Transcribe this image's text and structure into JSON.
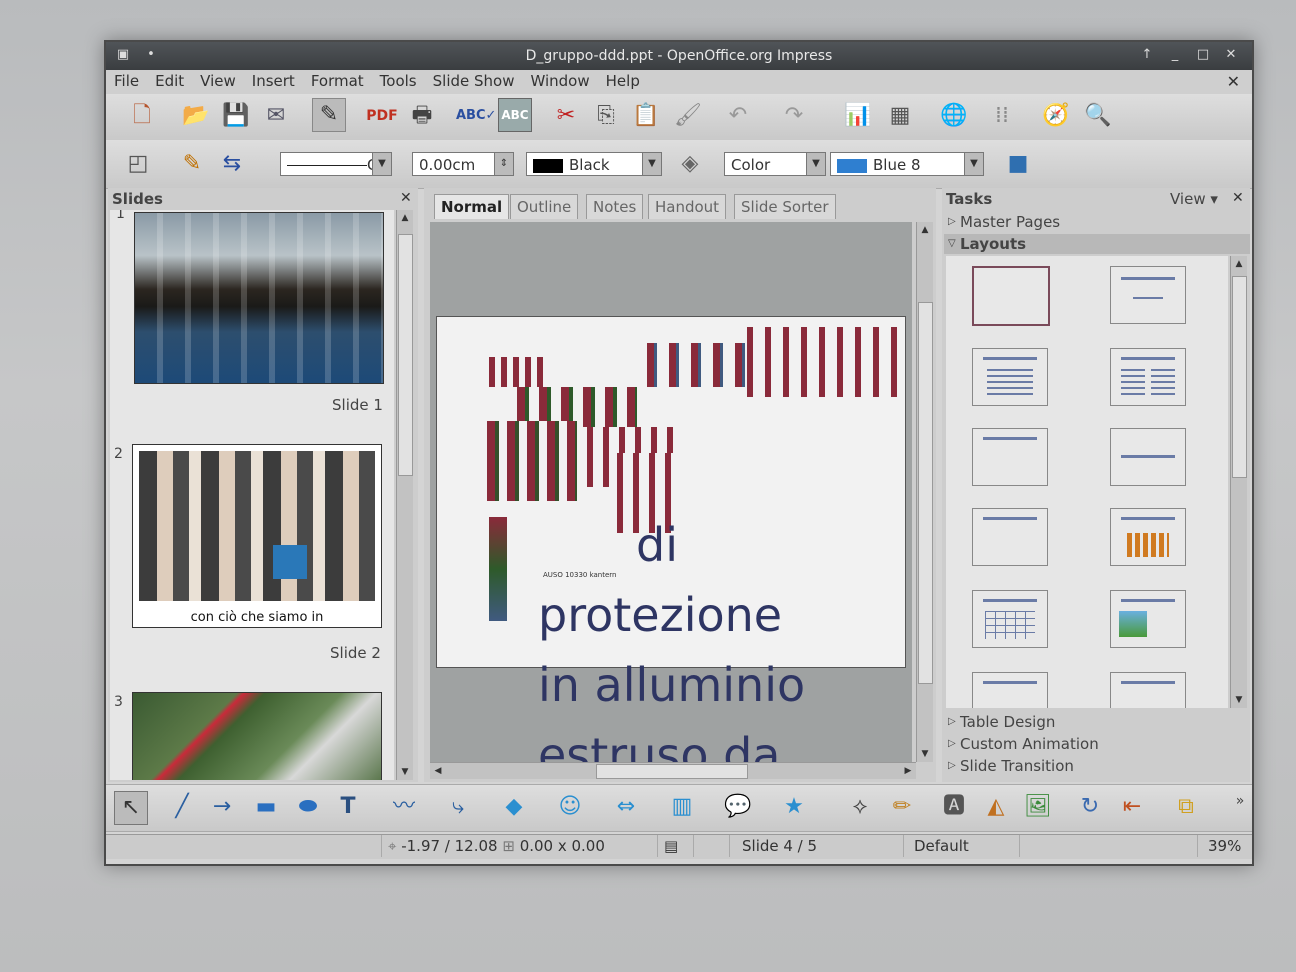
{
  "window": {
    "title": "D_gruppo-ddd.ppt - OpenOffice.org Impress"
  },
  "menu": [
    "File",
    "Edit",
    "View",
    "Insert",
    "Format",
    "Tools",
    "Slide Show",
    "Window",
    "Help"
  ],
  "line_toolbar": {
    "line_style_value": "C",
    "line_width": "0.00cm",
    "line_color": "Black",
    "area_style": "Color",
    "area_color": "Blue 8"
  },
  "slides_panel": {
    "title": "Slides",
    "slides": [
      {
        "number": "1",
        "label": "Slide 1"
      },
      {
        "number": "2",
        "label": "Slide 2",
        "caption": "con ciò che siamo in"
      },
      {
        "number": "3"
      }
    ]
  },
  "view_tabs": [
    "Normal",
    "Outline",
    "Notes",
    "Handout",
    "Slide Sorter"
  ],
  "slide": {
    "small_text": "AUSO 10330 kantern",
    "line1": "di",
    "line2": "protezione",
    "line3": "in alluminio",
    "line4": "estruso da"
  },
  "tasks_panel": {
    "title": "Tasks",
    "view_label": "View",
    "sections": {
      "master_pages": "Master Pages",
      "layouts": "Layouts",
      "table_design": "Table Design",
      "custom_animation": "Custom Animation",
      "slide_transition": "Slide Transition"
    }
  },
  "status_bar": {
    "position": "-1.97 / 12.08",
    "size": "0.00 x 0.00",
    "slide": "Slide 4 / 5",
    "master": "Default",
    "zoom": "39%"
  },
  "colors": {
    "title_bar": "#3f4245",
    "slide_text": "#2e3563",
    "area_blue": "#2f7fd0"
  }
}
